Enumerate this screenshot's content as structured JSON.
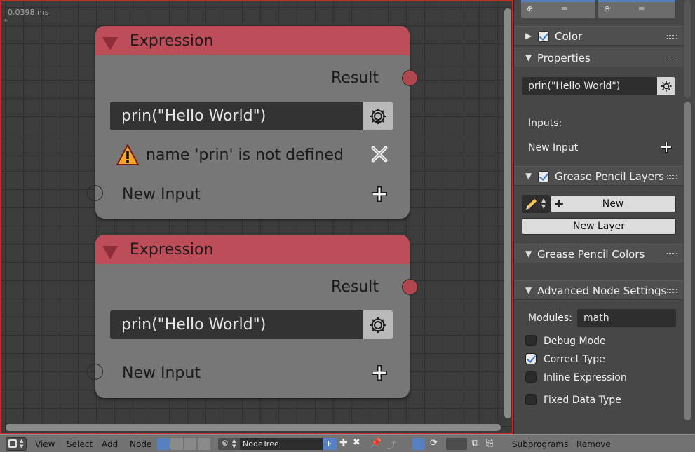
{
  "editor": {
    "timing": "0.0398 ms",
    "nodes": [
      {
        "title": "Expression",
        "output_label": "Result",
        "expression": "prin(\"Hello World\")",
        "error": "name 'prin' is not defined",
        "new_input_label": "New Input"
      },
      {
        "title": "Expression",
        "output_label": "Result",
        "expression": "prin(\"Hello World\")",
        "new_input_label": "New Input"
      }
    ]
  },
  "sidebar": {
    "color_panel": {
      "label": "Color",
      "enabled": true
    },
    "properties_panel": {
      "label": "Properties",
      "expression": "prin(\"Hello World\")",
      "inputs_label": "Inputs:",
      "new_input_label": "New Input"
    },
    "grease_pencil_layers": {
      "label": "Grease Pencil Layers",
      "enabled": true,
      "new_button": "New",
      "new_layer_button": "New Layer"
    },
    "grease_pencil_colors": {
      "label": "Grease Pencil Colors"
    },
    "advanced": {
      "label": "Advanced Node Settings",
      "modules_label": "Modules:",
      "modules_value": "math",
      "options": [
        {
          "label": "Debug Mode",
          "checked": false
        },
        {
          "label": "Correct Type",
          "checked": true
        },
        {
          "label": "Inline Expression",
          "checked": false
        },
        {
          "label": "Fixed Data Type",
          "checked": false
        }
      ]
    }
  },
  "footer": {
    "menus": [
      "View",
      "Select",
      "Add",
      "Node"
    ],
    "node_tree": "NodeTree",
    "fake_user": "F",
    "extra_menus": [
      "Subprograms",
      "Remove"
    ]
  },
  "colors": {
    "node_header": "#bd4d59",
    "node_body": "#777777",
    "socket": "#b0474f",
    "active_border": "#c62b2b",
    "accent": "#5680c2"
  }
}
